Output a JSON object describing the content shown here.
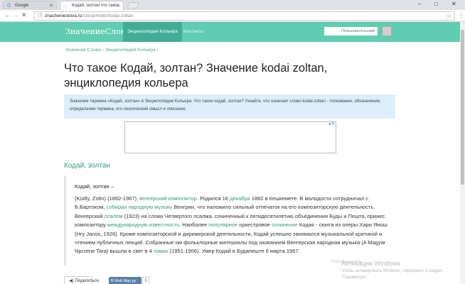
{
  "browser": {
    "tabs": [
      {
        "title": "Google",
        "icon": "google-favicon",
        "active": false
      },
      {
        "title": "Кодай, золтан что тако...",
        "icon": "site-favicon",
        "active": true
      }
    ],
    "address": {
      "host": "znachenieslova.ru",
      "path": "/slovar/koler/kodai-zoltan"
    },
    "controls": {
      "minimize": "–",
      "maximize": "□",
      "close": "✕"
    }
  },
  "site": {
    "logo": "ЗначениеСлова.ru",
    "nav": [
      "Энциклопедия Кольера",
      "Контакты"
    ],
    "search_placeholder": "Пользовательский"
  },
  "breadcrumb": "Значение Слова › Энциклопедия Кольера ›",
  "page_title": "Что такое Кодай, золтан? Значение kodai zoltan, энциклопедия кольера",
  "intro": "Значение термина «Кодай, золтан» в Энциклопедии Кольера. Что такое кодай, золтан? Узнайте, что означает слово kodai-zoltan - толкование, обозначение, определение термина, его лексический смысл и описание.",
  "section_title": "Кодай, золтан",
  "article": {
    "headword": "Кодай, золтан –",
    "p1": "(Kodly, Zoltn) (1882-1967), ",
    "l1": "венгерский композитор",
    "p2": ". Родился 16 ",
    "l2": "декабря",
    "p3": " 1882 в Кешкемете. В молодости сотрудничал с Б.Бартоком, ",
    "l3": "собирал народную",
    "p4": " ",
    "l4": "музыку",
    "p5": " Венгрии, что наложило сильный отпечаток на его композиторскую деятельность. Венгерский ",
    "l5": "псалом",
    "p6": " (1923) на слова Четвертого псалма, сочиненный к пятидесятилетию объединения Буды и Пешта, принес композитору ",
    "l6": "международную известность",
    "p7": ". Наиболее ",
    "l7": "популярное",
    "p8": " оркестровое ",
    "l8": "сочинение",
    "p9": " Кодая - сюита из оперы Хари Янош (Hry Janos, 1926). Кроме композиторской и дирижерской деятельности, Кодай успешно занимался музыкальной критикой и чтением публичных лекций. Собранные им фольклорные материалы под названием Венгерская народная музыка (A Magyar Nprzene Tara) вышли в свет в 4 ",
    "l9": "томах",
    "p10": " (1951-1956). Умер Кодай в Будапеште 6 марта 1967."
  },
  "share": {
    "share_label": "Поделиться",
    "vk_label": "В Мой Мир.ру",
    "vk_count": "0"
  },
  "watermark": {
    "ghost": "Рекламодатель",
    "title": "Активация Windows",
    "line1": "Чтобы активировать Windows, перейдите в раздел",
    "line2": "\"Параметры\"."
  },
  "colors": {
    "header": "#5ecdb1",
    "accent": "#2f9c7d",
    "intro_bg": "#dbeefa"
  }
}
